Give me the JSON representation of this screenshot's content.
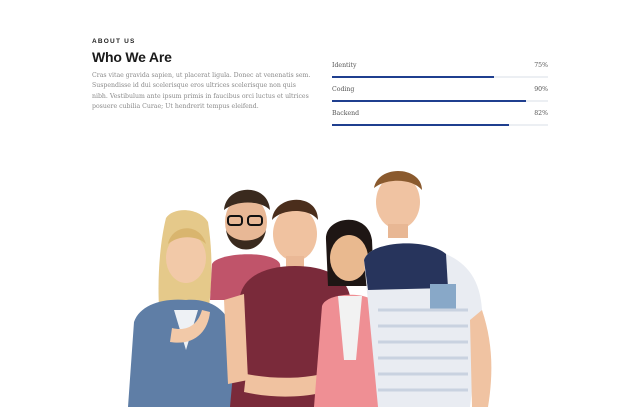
{
  "about": {
    "eyebrow": "ABOUT US",
    "title": "Who We Are",
    "description": "Cras vitae gravida sapien, ut placerat ligula. Donec at venenatis sem. Suspendisse id dui scelerisque eros ultrices scelerisque non quis nibh. Vestibulum ante ipsum primis in faucibus orci luctus et ultrices posuere cubilia Curae; Ut hendrerit tempus eleifend."
  },
  "skills": [
    {
      "label": "Identity",
      "value_text": "75%",
      "percent": 75
    },
    {
      "label": "Coding",
      "value_text": "90%",
      "percent": 90
    },
    {
      "label": "Backend",
      "value_text": "82%",
      "percent": 82
    }
  ],
  "colors": {
    "bar": "#1f3f8f",
    "track": "#eceff3"
  },
  "image": {
    "subject": "group-of-five-young-people"
  }
}
